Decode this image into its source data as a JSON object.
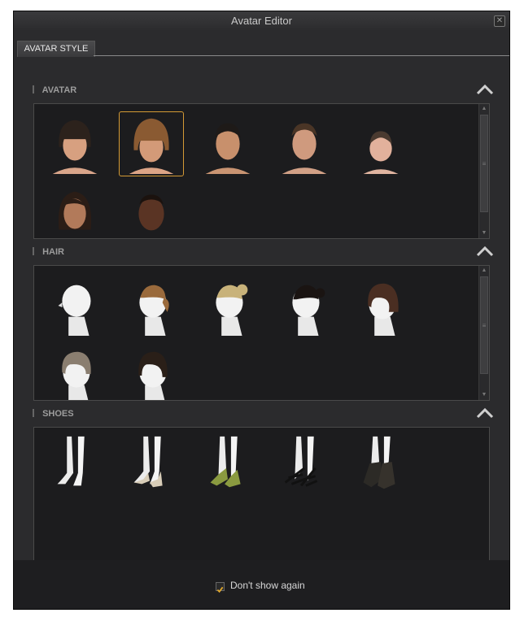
{
  "window": {
    "title": "Avatar Editor"
  },
  "tabs": [
    {
      "label": "AVATAR STYLE"
    }
  ],
  "sections": {
    "avatar": {
      "title": "AVATAR",
      "items": [
        {
          "name": "avatar-female-bangs-dark"
        },
        {
          "name": "avatar-female-bangs-brown",
          "selected": true
        },
        {
          "name": "avatar-male-asian"
        },
        {
          "name": "avatar-male-caucasian"
        },
        {
          "name": "avatar-child"
        },
        {
          "name": "avatar-female-dark-hair"
        },
        {
          "name": "avatar-male-dark-skin"
        }
      ]
    },
    "hair": {
      "title": "HAIR",
      "items": [
        {
          "name": "hair-bald"
        },
        {
          "name": "hair-ponytail-brown"
        },
        {
          "name": "hair-bun-blonde"
        },
        {
          "name": "hair-bun-black"
        },
        {
          "name": "hair-bob-brown"
        },
        {
          "name": "hair-short-ash"
        },
        {
          "name": "hair-bob-dark"
        }
      ]
    },
    "shoes": {
      "title": "SHOES",
      "items": [
        {
          "name": "shoes-barefoot"
        },
        {
          "name": "shoes-heels-cream"
        },
        {
          "name": "shoes-heels-green"
        },
        {
          "name": "shoes-sandals-black"
        },
        {
          "name": "shoes-booties-dark"
        }
      ]
    }
  },
  "footer": {
    "dont_show_again": "Don't show again",
    "checked": true
  },
  "colors": {
    "accent": "#d49a35",
    "background": "#2b2b2d",
    "grid": "#1c1c1e"
  }
}
